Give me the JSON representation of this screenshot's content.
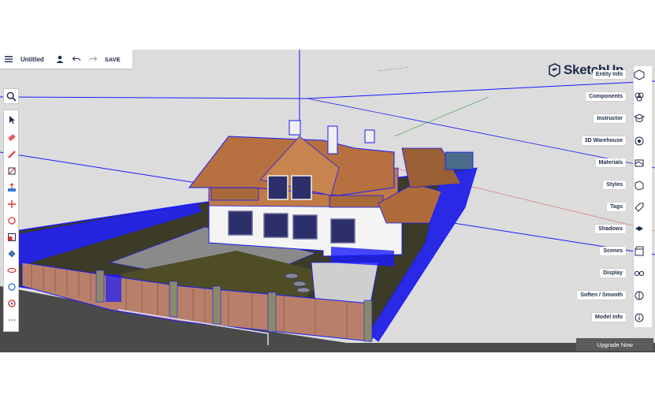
{
  "topbar": {
    "title": "Untitled",
    "save_label": "SAVE",
    "icons": [
      "menu-icon",
      "user-icon",
      "undo-icon",
      "redo-icon"
    ]
  },
  "logo": {
    "text": "SketchUp"
  },
  "left_tools": {
    "items": [
      "search-icon",
      "select-icon",
      "eraser-icon",
      "pencil-icon",
      "rectangle-icon",
      "push-pull-icon",
      "move-icon",
      "rotate-icon",
      "scale-icon",
      "paint-bucket-icon",
      "orbit-icon",
      "tape-measure-icon",
      "section-plane-icon",
      "more-icon"
    ]
  },
  "right_panel": {
    "items": [
      {
        "label": "Entity Info",
        "icon": "entity-info-icon"
      },
      {
        "label": "Components",
        "icon": "components-icon"
      },
      {
        "label": "Instructor",
        "icon": "instructor-icon"
      },
      {
        "label": "3D Warehouse",
        "icon": "warehouse-icon"
      },
      {
        "label": "Materials",
        "icon": "materials-icon"
      },
      {
        "label": "Styles",
        "icon": "styles-icon"
      },
      {
        "label": "Tags",
        "icon": "tags-icon"
      },
      {
        "label": "Shadows",
        "icon": "shadows-icon"
      },
      {
        "label": "Scenes",
        "icon": "scenes-icon"
      },
      {
        "label": "Display",
        "icon": "display-icon"
      },
      {
        "label": "Soften / Smooth",
        "icon": "soften-icon"
      },
      {
        "label": "Model Info",
        "icon": "model-info-icon"
      }
    ]
  },
  "upgrade": {
    "label": "Upgrade Now"
  },
  "colors": {
    "accent": "#1d2a4b",
    "selection": "#1a1aff",
    "roof": "#b7703f",
    "fence": "#b8806a",
    "ground": "#4b4b4b",
    "grass": "#5b5b2b"
  }
}
